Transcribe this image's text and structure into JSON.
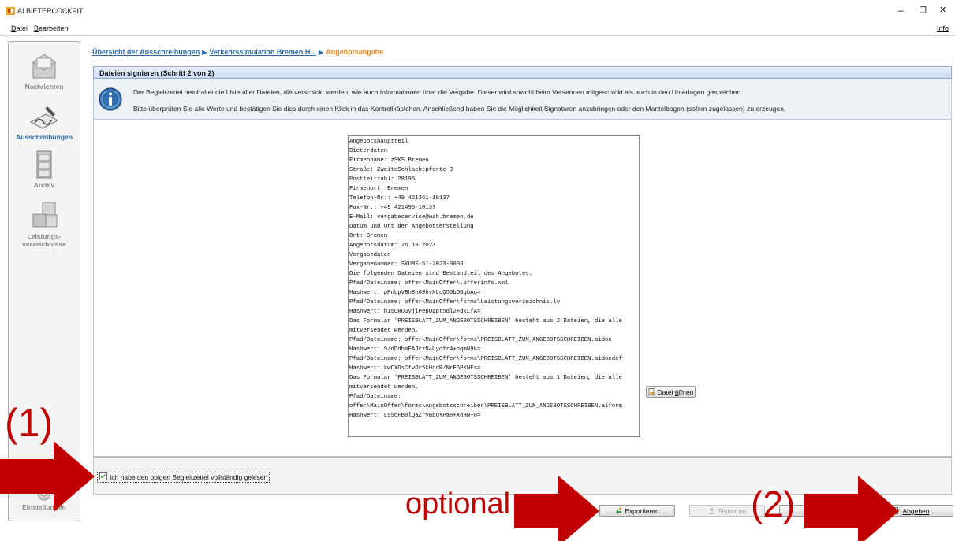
{
  "window": {
    "title": "AI BIETERCOCKPIT",
    "controls": [
      "–",
      "❐",
      "✕"
    ]
  },
  "menu": {
    "items": [
      {
        "mnemonic": "D",
        "rest": "atei"
      },
      {
        "mnemonic": "B",
        "rest": "earbeiten"
      }
    ],
    "info_label": "Info"
  },
  "sidebar": {
    "items": [
      {
        "label": "Nachrichten",
        "icon": "mail-icon"
      },
      {
        "label": "Ausschreibungen",
        "icon": "signature-icon",
        "active": true
      },
      {
        "label": "Archiv",
        "icon": "archive-cabinet-icon"
      },
      {
        "label_line1": "Leistungs-",
        "label_line2": "verzeichnisse",
        "icon": "boxes-icon"
      },
      {
        "label": "Einstellungen",
        "icon": "gear-icon"
      }
    ]
  },
  "breadcrumb": {
    "items": [
      "Übersicht der Ausschreibungen",
      "Verkehrssimulation Bremen H..."
    ],
    "current": "Angebotsabgabe",
    "separator": "▶"
  },
  "step": {
    "title": "Dateien signieren (Schritt 2 von 2)"
  },
  "info": {
    "line1": "Der Begleitzettel beinhaltet die Liste aller Dateien, die verschickt werden, wie auch Informationen über die Vergabe. Dieser wird sowohl beim Versenden mitgeschickt als auch in den Unterlagen gespeichert.",
    "line2": "Bitte überprüfen Sie alle Werte und bestätigen Sie dies durch einen Klick in das Kontrollkästchen. Anschließend haben Sie die Möglichkeit Signaturen anzubringen oder den Mantelbogen (sofern zugelassen) zu erzeugen."
  },
  "document": {
    "lines": [
      "Angebotshauptteil",
      "Bieterdaten",
      "Firmenname: zSKS Bremen",
      "Straße: ZweiteSchlachtpforte 3",
      "Postleitzahl: 28195",
      "Firmenort: Bremen",
      "Telefon-Nr.: +49 421361-10137",
      "Fax-Nr.: +49 421496-10137",
      "E-Mail: vergabeservice@wah.bremen.de",
      "Datum und Ort der Angebotserstellung",
      "Ort: Bremen",
      "Angebotsdatum: 26.10.2023",
      "Vergabedaten",
      "Vergabenummer: SKUMS-51-2023-0003",
      "Die folgenden Dateien sind Bestandteil des Angebotes.",
      "Pfad/Dateiname: offer\\MainOffer\\.offerinfo.xml",
      "Hashwert: pPnbpVBh8h69hvNLuQ50bOBqbAg=",
      "Pfad/Dateiname: offer\\MainOffer\\forms\\Leistungsverzeichnis.lv",
      "Hashwert: hI5UROGyjlPepOzpt5dl2+dkLfA=",
      "Das Formular 'PREISBLATT_ZUM_ANGEBOTSSCHREIBEN' besteht aus 2 Dateien, die alle",
      "mitversendet werden.",
      "Pfad/Dateiname: offer\\MainOffer\\forms\\PREISBLATT_ZUM_ANGEBOTSSCHREIBEN.aidoc",
      "Hashwert: 9/dDdbaEAJczN4Uyofr4+pqmN9k=",
      "Pfad/Dateiname: offer\\MainOffer\\forms\\PREISBLATT_ZUM_ANGEBOTSSCHREIBEN.aidocdef",
      "Hashwert: kwCXDsCfvOr5kHndR/NrE6PKNEs=",
      "Das Formular 'PREISBLATT_ZUM_ANGEBOTSSCHREIBEN' besteht aus 1 Dateien, die alle",
      "mitversendet werden.",
      "Pfad/Dateiname:",
      "offer\\MainOffer\\forms\\Angebotsschreiben\\PREISBLATT_ZUM_ANGEBOTSSCHREIBEN.aiform",
      "Hashwert: L95dFB8lQaZrVBbQYPa8+XoHN+0="
    ],
    "open_button_prefix": "Datei ",
    "open_button_mnemonic": "ö",
    "open_button_suffix": "ffnen"
  },
  "confirm": {
    "checkbox_label": "Ich habe den obigen Begleitzettel vollständig gelesen",
    "checked": true
  },
  "actions": {
    "export_label": "Exportieren",
    "sign_label": "Signieren",
    "submit_label": "Abgeben"
  },
  "annotations": {
    "label_1": "(1)",
    "label_optional": "optional",
    "label_2": "(2)",
    "color": "#c00000"
  }
}
